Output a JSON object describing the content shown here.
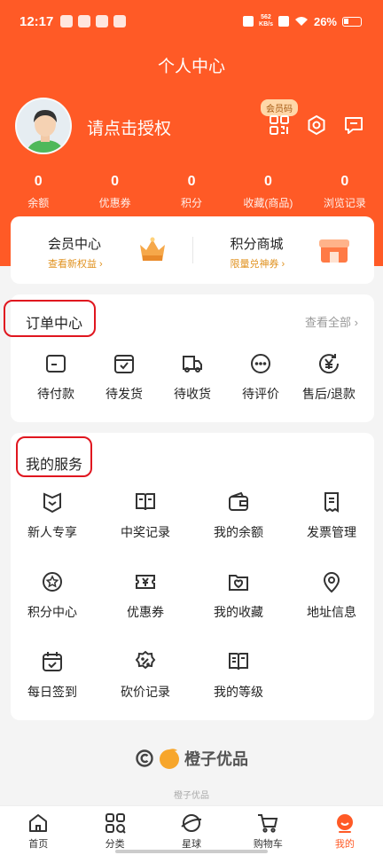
{
  "status_bar": {
    "time": "12:17",
    "net_speed": "562",
    "net_unit": "KB/s",
    "battery": "26%"
  },
  "header": {
    "title": "个人中心",
    "username": "请点击授权",
    "vip_code_tag": "会员码"
  },
  "stats": [
    {
      "value": "0",
      "label": "余额"
    },
    {
      "value": "0",
      "label": "优惠券"
    },
    {
      "value": "0",
      "label": "积分"
    },
    {
      "value": "0",
      "label": "收藏(商品)"
    },
    {
      "value": "0",
      "label": "浏览记录"
    }
  ],
  "vip": {
    "center_title": "会员中心",
    "center_sub": "查看新权益 ›",
    "mall_title": "积分商城",
    "mall_sub": "限量兑神券 ›"
  },
  "orders": {
    "title": "订单中心",
    "see_all": "查看全部 ›",
    "items": [
      {
        "label": "待付款",
        "icon": "wallet-card-icon"
      },
      {
        "label": "待发货",
        "icon": "box-check-icon"
      },
      {
        "label": "待收货",
        "icon": "truck-icon"
      },
      {
        "label": "待评价",
        "icon": "chat-dots-icon"
      },
      {
        "label": "售后/退款",
        "icon": "yen-refresh-icon"
      }
    ]
  },
  "services": {
    "title": "我的服务",
    "items": [
      {
        "label": "新人专享",
        "icon": "gift-badge-icon"
      },
      {
        "label": "中奖记录",
        "icon": "book-icon"
      },
      {
        "label": "我的余额",
        "icon": "wallet-icon"
      },
      {
        "label": "发票管理",
        "icon": "invoice-icon"
      },
      {
        "label": "积分中心",
        "icon": "star-circle-icon"
      },
      {
        "label": "优惠券",
        "icon": "coupon-icon"
      },
      {
        "label": "我的收藏",
        "icon": "heart-folder-icon"
      },
      {
        "label": "地址信息",
        "icon": "location-pin-icon"
      },
      {
        "label": "每日签到",
        "icon": "calendar-check-icon"
      },
      {
        "label": "砍价记录",
        "icon": "discount-badge-icon"
      },
      {
        "label": "我的等级",
        "icon": "level-book-icon"
      }
    ]
  },
  "footer": {
    "brand": "橙子优品",
    "caption": "橙子优品"
  },
  "tabbar": [
    {
      "label": "首页",
      "icon": "home-icon"
    },
    {
      "label": "分类",
      "icon": "category-grid-icon"
    },
    {
      "label": "星球",
      "icon": "planet-icon"
    },
    {
      "label": "购物车",
      "icon": "cart-icon"
    },
    {
      "label": "我的",
      "icon": "profile-icon"
    }
  ],
  "colors": {
    "brand": "#ff5a26",
    "accent_gold": "#e0911e",
    "highlight_box": "#e0161f"
  }
}
